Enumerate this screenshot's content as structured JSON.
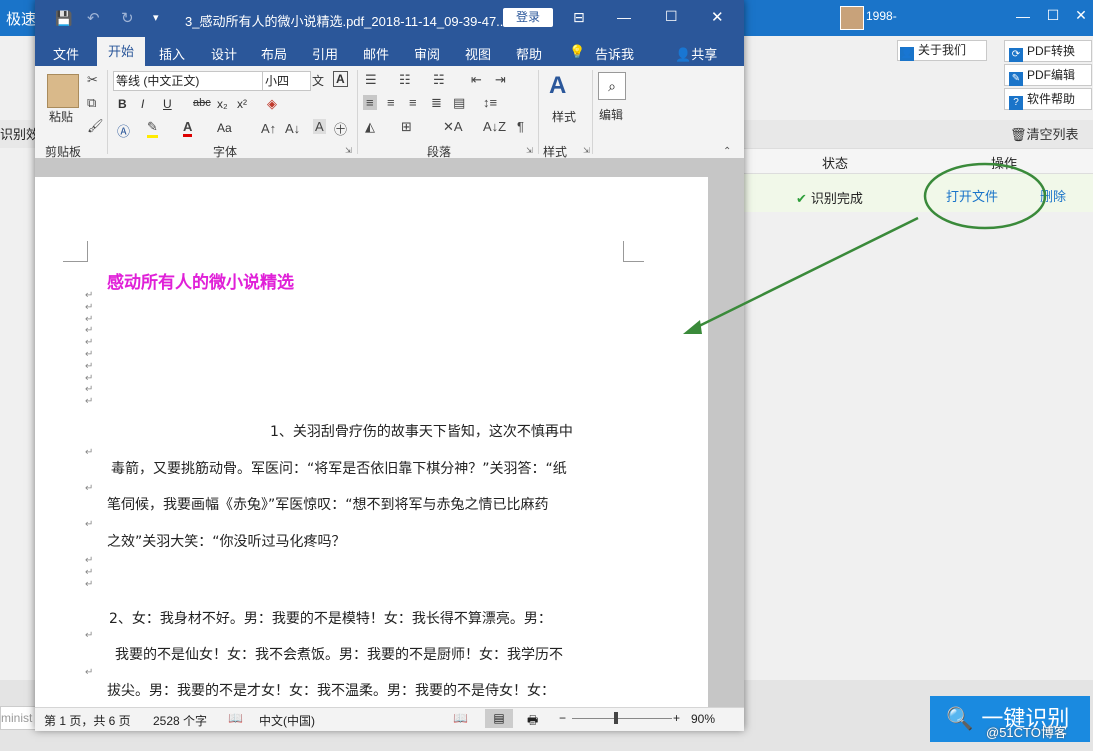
{
  "bg_app": {
    "title": "极速",
    "user": "1998-",
    "about_label": "关于我们",
    "pdf_convert_label": "PDF转换",
    "pdf_edit_label": "PDF编辑",
    "help_label": "软件帮助",
    "left_label": "识别效",
    "clear_list": "清空列表",
    "col_status": "状态",
    "col_ops": "操作",
    "row_status": "识别完成",
    "open_file": "打开文件",
    "delete": "删除",
    "input_value": "minist",
    "one_click_label": "一键识别",
    "watermark": "@51CTO博客"
  },
  "word": {
    "title": "3_感动所有人的微小说精选.pdf_2018-11-14_09-39-47...",
    "login": "登录",
    "tabs": [
      "文件",
      "开始",
      "插入",
      "设计",
      "布局",
      "引用",
      "邮件",
      "审阅",
      "视图",
      "帮助",
      "告诉我",
      "共享"
    ],
    "ribbon": {
      "paste": "粘贴",
      "clipboard": "剪贴板",
      "font_name": "等线 (中文正文)",
      "font_size": "小四",
      "font_group": "字体",
      "paragraph_group": "段落",
      "styles_button": "样式",
      "styles_group": "样式",
      "edit_button": "编辑",
      "bold": "B",
      "italic": "I",
      "underline": "U",
      "strike": "abc",
      "sub": "x₂",
      "sup": "x²",
      "aa": "Aa",
      "wen": "文",
      "A_box": "A"
    },
    "doc": {
      "title": "感动所有人的微小说精选",
      "lines": [
        "1、关羽刮骨疗伤的故事天下皆知，这次不慎再中",
        "毒箭，又要挑筋动骨。军医问：“将军是否依旧靠下棋分神？”关羽答：“纸",
        "笔伺候，我要画幅《赤兔》”军医惊叹：“想不到将军与赤兔之情已比麻药",
        "之效”关羽大笑：“你没听过马化疼吗？",
        "2、女：我身材不好。男：我要的不是模特！女：我长得不算漂亮。男：",
        "我要的不是仙女！女：我不会煮饭。男：我要的不是厨师！女：我学历不",
        "拔尖。男：我要的不是才女！女：我不温柔。男：我要的不是侍女！女："
      ]
    },
    "status": {
      "page": "第 1 页，共 6 页",
      "words": "2528 个字",
      "lang": "中文(中国)",
      "zoom": "90%"
    }
  },
  "colors": {
    "word_blue": "#2b579a",
    "app_blue": "#1a74c9",
    "title_magenta": "#e020d8",
    "annotation_green": "#3a8a3a"
  }
}
